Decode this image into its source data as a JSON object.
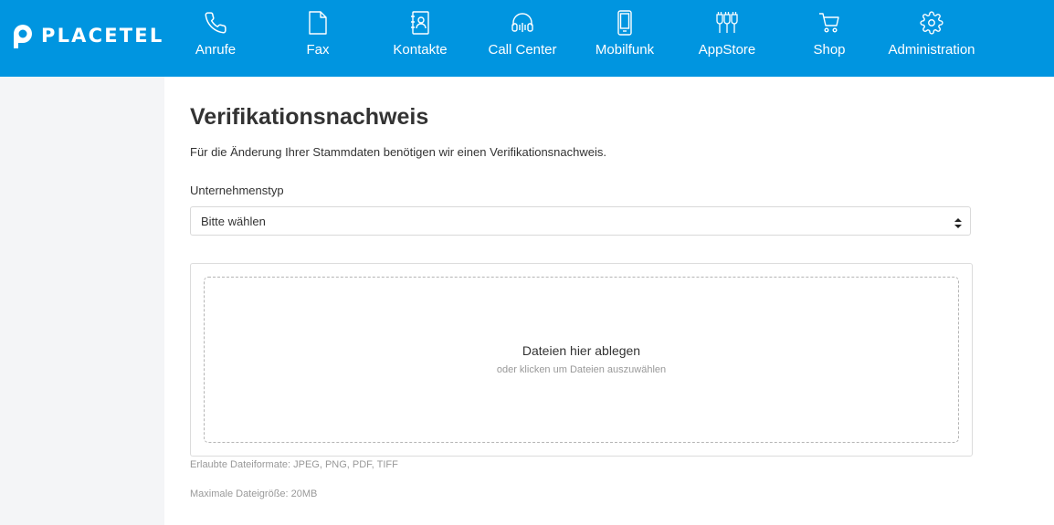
{
  "brand": {
    "name": "PLACETEL"
  },
  "nav": {
    "items": [
      {
        "label": "Anrufe",
        "icon": "phone-icon"
      },
      {
        "label": "Fax",
        "icon": "document-icon"
      },
      {
        "label": "Kontakte",
        "icon": "contacts-icon"
      },
      {
        "label": "Call Center",
        "icon": "headset-icon"
      },
      {
        "label": "Mobilfunk",
        "icon": "mobile-icon"
      },
      {
        "label": "AppStore",
        "icon": "plug-icon"
      },
      {
        "label": "Shop",
        "icon": "cart-icon"
      },
      {
        "label": "Administration",
        "icon": "gear-icon"
      }
    ]
  },
  "main": {
    "title": "Verifikationsnachweis",
    "intro": "Für die Änderung Ihrer Stammdaten benötigen wir einen Verifikationsnachweis.",
    "company_type": {
      "label": "Unternehmenstyp",
      "value": "Bitte wählen"
    },
    "upload": {
      "title": "Dateien hier ablegen",
      "subtitle": "oder klicken um Dateien auszuwählen",
      "formats": "Erlaubte Dateiformate: JPEG, PNG, PDF, TIFF",
      "max_size": "Maximale Dateigröße: 20MB"
    }
  },
  "colors": {
    "header": "#0095e0",
    "sidebar": "#f4f5f7",
    "content": "#ffffff"
  }
}
